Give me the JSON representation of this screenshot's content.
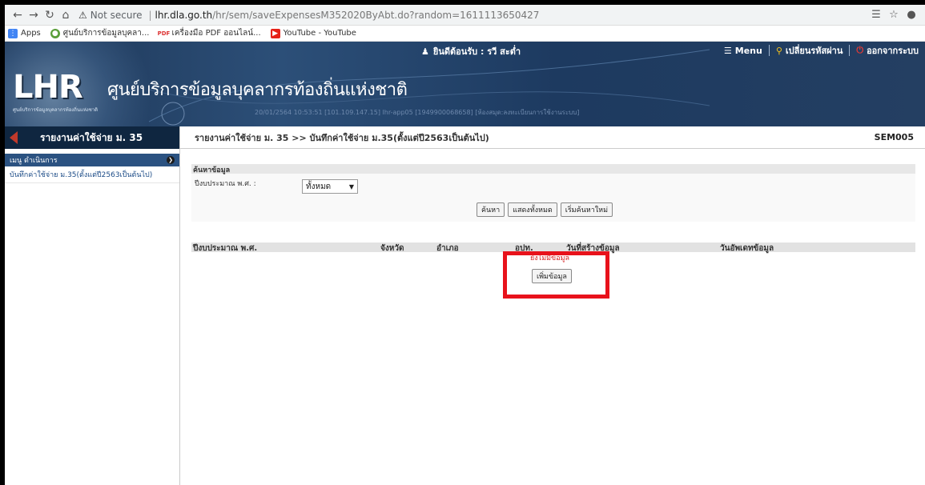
{
  "browser": {
    "not_secure": "Not secure",
    "url_host": "lhr.dla.go.th",
    "url_path": "/hr/sem/saveExpensesM352020ByAbt.do?random=1611113650427",
    "bookmarks": [
      {
        "label": "Apps",
        "icon": "apps-grid-icon"
      },
      {
        "label": "ศูนย์บริการข้อมูลบุคลา...",
        "icon": "site-icon"
      },
      {
        "label": "เครื่องมือ PDF ออนไลน์...",
        "icon": "pdf-icon"
      },
      {
        "label": "YouTube - YouTube",
        "icon": "youtube-icon"
      }
    ]
  },
  "header": {
    "logo": "LHR",
    "logo_sub": "ศูนย์บริการข้อมูลบุคลากรท้องถิ่นแห่งชาติ",
    "site_title": "ศูนย์บริการข้อมูลบุคลากรท้องถิ่นแห่งชาติ",
    "session": "20/01/2564 10:53:51 [101.109.147.15] lhr-app05 [1949900068658] [ห้องสมุด:ลงทะเบียนการใช้งานระบบ]",
    "welcome": "ยินดีต้อนรับ : รวี สะต่ำ",
    "menu": "Menu",
    "change_password": "เปลี่ยนรหัสผ่าน",
    "logout": "ออกจากระบบ"
  },
  "sidebar": {
    "title": "รายงานค่าใช้จ่าย ม. 35",
    "menu_label": "เมนู ดำเนินการ",
    "items": [
      "บันทึกค่าใช้จ่าย ม.35(ตั้งแต่ปี2563เป็นต้นไป)"
    ]
  },
  "main": {
    "breadcrumb": "รายงานค่าใช้จ่าย ม. 35 >> บันทึกค่าใช้จ่าย ม.35(ตั้งแต่ปี2563เป็นต้นไป)",
    "code": "SEM005",
    "search_panel_title": "ค้นหาข้อมูล",
    "fiscal_year_label": "ปีงบประมาณ พ.ศ. :",
    "fiscal_year_value": "ทั้งหมด",
    "buttons": {
      "search": "ค้นหา",
      "show_all": "แสดงทั้งหมด",
      "reset": "เริ่มค้นหาใหม่"
    },
    "columns": [
      "ปีงบประมาณ พ.ศ.",
      "จังหวัด",
      "อำเภอ",
      "อปท.",
      "วันที่สร้างข้อมูล",
      "วันอัพเดทข้อมูล"
    ],
    "no_data": "ยังไม่มีข้อมูล",
    "add_button": "เพิ่มข้อมูล"
  },
  "colors": {
    "highlight": "#e8121b",
    "header_bg": "#1d3555",
    "sidebar_head": "#0f2640"
  }
}
